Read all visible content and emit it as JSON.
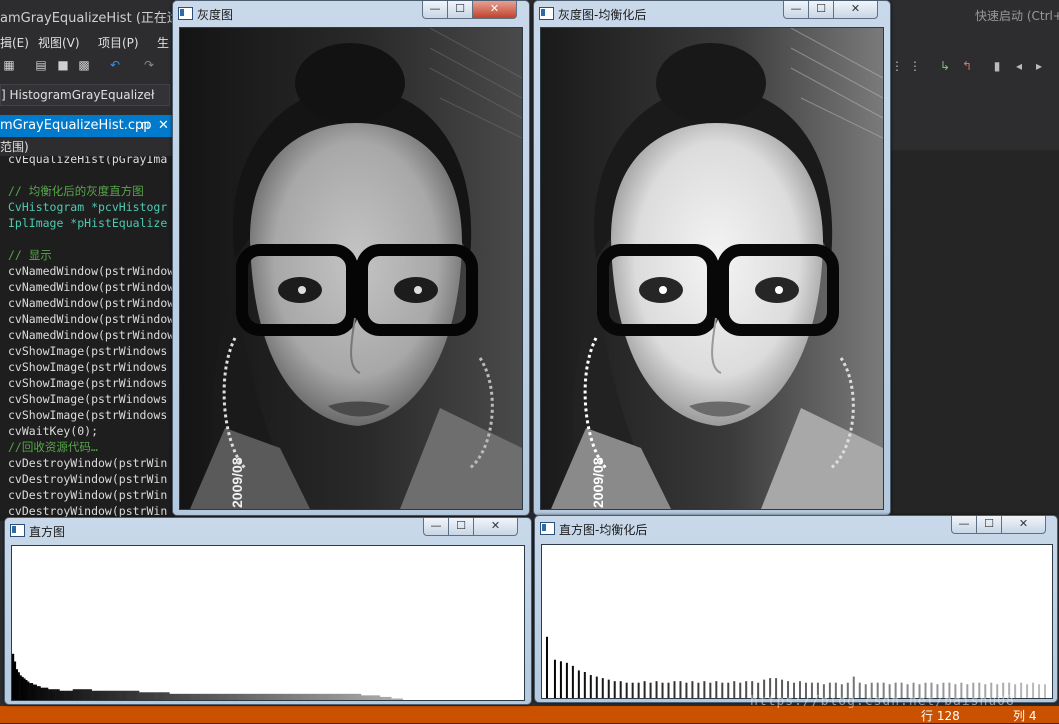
{
  "vs": {
    "title": "amGrayEqualizeHist (正在运行",
    "quick_launch": "快速启动 (Ctrl+",
    "menu": [
      "揖(E)",
      "视图(V)",
      "项目(P)",
      "生"
    ],
    "config": "] HistogramGrayEqualizeł",
    "tab_label": "mGrayEqualizeHist.cpp",
    "tab_pin": "⊓",
    "tab_close": "✕",
    "scope": "范围)",
    "code": [
      {
        "text": "cvEqualizeHist(pGrayIma",
        "kind": "code"
      },
      {
        "text": "",
        "kind": "code"
      },
      {
        "text": "// 均衡化后的灰度直方图",
        "kind": "cm"
      },
      {
        "text": "CvHistogram *pcvHistogr",
        "kind": "ty"
      },
      {
        "text": "IplImage *pHistEqualize",
        "kind": "ty"
      },
      {
        "text": "",
        "kind": "code"
      },
      {
        "text": "// 显示",
        "kind": "cm"
      },
      {
        "text": "cvNamedWindow(pstrWindow",
        "kind": "code"
      },
      {
        "text": "cvNamedWindow(pstrWindow",
        "kind": "code"
      },
      {
        "text": "cvNamedWindow(pstrWindow",
        "kind": "code"
      },
      {
        "text": "cvNamedWindow(pstrWindow",
        "kind": "code"
      },
      {
        "text": "cvNamedWindow(pstrWindow",
        "kind": "code"
      },
      {
        "text": "cvShowImage(pstrWindows",
        "kind": "code"
      },
      {
        "text": "cvShowImage(pstrWindows",
        "kind": "code"
      },
      {
        "text": "cvShowImage(pstrWindows",
        "kind": "code"
      },
      {
        "text": "cvShowImage(pstrWindows",
        "kind": "code"
      },
      {
        "text": "cvShowImage(pstrWindows",
        "kind": "code"
      },
      {
        "text": "cvWaitKey(0);",
        "kind": "code"
      },
      {
        "text": "//回收资源代码…",
        "kind": "cm"
      },
      {
        "text": "cvDestroyWindow(pstrWin",
        "kind": "code"
      },
      {
        "text": "cvDestroyWindow(pstrWin",
        "kind": "code"
      },
      {
        "text": "cvDestroyWindow(pstrWin",
        "kind": "code"
      },
      {
        "text": "cvDestroyWindow(pstrWin",
        "kind": "code"
      }
    ],
    "status_line": "行 128",
    "status_col": "列 4",
    "watermark": "https://blog.csdn.net/baishu08"
  },
  "windows": {
    "gray": {
      "title": "灰度图",
      "photo_stamp": "2009/08"
    },
    "equalized": {
      "title": "灰度图-均衡化后",
      "photo_stamp": "2009/08"
    },
    "hist": {
      "title": "直方图"
    },
    "hist_eq": {
      "title": "直方图-均衡化后"
    }
  },
  "controls": {
    "minimize": "—",
    "maximize": "☐",
    "close": "✕"
  },
  "icons": [
    "minimize-icon",
    "maximize-icon",
    "close-icon",
    "window-app-icon"
  ],
  "colors": {
    "vs_accent": "#007acc",
    "vs_status": "#ca5100",
    "close_hover": "#c1422c"
  },
  "chart_data": [
    {
      "type": "bar",
      "title": "直方图",
      "xlabel": "",
      "ylabel": "",
      "xlim": [
        0,
        255
      ],
      "ylim": [
        0,
        1
      ],
      "grid": false,
      "values": [
        0.3,
        0.25,
        0.2,
        0.18,
        0.16,
        0.15,
        0.14,
        0.13,
        0.12,
        0.11,
        0.11,
        0.1,
        0.1,
        0.09,
        0.09,
        0.08,
        0.08,
        0.08,
        0.08,
        0.07,
        0.07,
        0.07,
        0.07,
        0.07,
        0.07,
        0.06,
        0.06,
        0.06,
        0.06,
        0.06,
        0.06,
        0.06,
        0.07,
        0.07,
        0.07,
        0.07,
        0.07,
        0.07,
        0.07,
        0.07,
        0.07,
        0.07,
        0.06,
        0.06,
        0.06,
        0.06,
        0.06,
        0.06,
        0.06,
        0.06,
        0.06,
        0.06,
        0.06,
        0.06,
        0.06,
        0.06,
        0.06,
        0.06,
        0.06,
        0.06,
        0.06,
        0.06,
        0.06,
        0.06,
        0.06,
        0.06,
        0.06,
        0.05,
        0.05,
        0.05,
        0.05,
        0.05,
        0.05,
        0.05,
        0.05,
        0.05,
        0.05,
        0.05,
        0.05,
        0.05,
        0.05,
        0.05,
        0.05,
        0.04,
        0.04,
        0.04,
        0.04,
        0.04,
        0.04,
        0.04,
        0.04,
        0.04,
        0.04,
        0.04,
        0.04,
        0.04,
        0.04,
        0.04,
        0.04,
        0.04,
        0.04,
        0.04,
        0.04,
        0.04,
        0.04,
        0.04,
        0.04,
        0.04,
        0.04,
        0.04,
        0.04,
        0.04,
        0.04,
        0.04,
        0.04,
        0.04,
        0.04,
        0.04,
        0.04,
        0.04,
        0.04,
        0.04,
        0.04,
        0.04,
        0.04,
        0.04,
        0.04,
        0.04,
        0.04,
        0.04,
        0.04,
        0.04,
        0.04,
        0.04,
        0.04,
        0.04,
        0.04,
        0.04,
        0.04,
        0.04,
        0.04,
        0.04,
        0.04,
        0.04,
        0.04,
        0.04,
        0.04,
        0.04,
        0.04,
        0.04,
        0.04,
        0.04,
        0.04,
        0.04,
        0.04,
        0.04,
        0.04,
        0.04,
        0.04,
        0.04,
        0.04,
        0.04,
        0.04,
        0.04,
        0.04,
        0.04,
        0.04,
        0.04,
        0.04,
        0.04,
        0.04,
        0.04,
        0.04,
        0.04,
        0.04,
        0.04,
        0.04,
        0.04,
        0.04,
        0.04,
        0.04,
        0.04,
        0.04,
        0.04,
        0.03,
        0.03,
        0.03,
        0.03,
        0.03,
        0.03,
        0.03,
        0.03,
        0.03,
        0.03,
        0.02,
        0.02,
        0.02,
        0.02,
        0.02,
        0.02,
        0.01,
        0.01,
        0.01,
        0.01,
        0.01,
        0.01,
        0,
        0,
        0,
        0,
        0,
        0,
        0,
        0,
        0,
        0,
        0,
        0,
        0,
        0,
        0,
        0,
        0,
        0,
        0,
        0,
        0,
        0,
        0,
        0,
        0,
        0,
        0,
        0,
        0,
        0,
        0,
        0,
        0,
        0,
        0,
        0,
        0,
        0,
        0,
        0,
        0,
        0,
        0,
        0,
        0,
        0,
        0,
        0,
        0,
        0,
        0,
        0,
        0,
        0,
        0,
        0,
        0,
        0,
        0,
        0,
        0,
        0,
        0,
        0
      ]
    },
    {
      "type": "bar",
      "title": "直方图-均衡化后",
      "xlabel": "",
      "ylabel": "",
      "xlim": [
        0,
        255
      ],
      "ylim": [
        0,
        1
      ],
      "grid": false,
      "bins": [
        2,
        6,
        9,
        12,
        15,
        18,
        21,
        24,
        27,
        30,
        33,
        36,
        39,
        42,
        45,
        48,
        51,
        54,
        57,
        60,
        63,
        66,
        69,
        72,
        75,
        78,
        81,
        84,
        87,
        90,
        93,
        96,
        99,
        102,
        105,
        108,
        111,
        114,
        117,
        120,
        123,
        126,
        129,
        132,
        135,
        138,
        141,
        144,
        147,
        150,
        153,
        156,
        159,
        162,
        165,
        168,
        171,
        174,
        177,
        180,
        183,
        186,
        189,
        192,
        195,
        198,
        201,
        204,
        207,
        210,
        213,
        216,
        219,
        222,
        225,
        228,
        231,
        234,
        237,
        240,
        243,
        246,
        249,
        252
      ],
      "values": [
        0.4,
        0.25,
        0.24,
        0.23,
        0.21,
        0.18,
        0.17,
        0.15,
        0.14,
        0.13,
        0.12,
        0.11,
        0.11,
        0.1,
        0.1,
        0.1,
        0.11,
        0.1,
        0.11,
        0.1,
        0.1,
        0.11,
        0.11,
        0.1,
        0.11,
        0.1,
        0.11,
        0.1,
        0.11,
        0.1,
        0.1,
        0.11,
        0.1,
        0.11,
        0.11,
        0.1,
        0.12,
        0.13,
        0.13,
        0.12,
        0.11,
        0.1,
        0.11,
        0.1,
        0.1,
        0.1,
        0.09,
        0.1,
        0.1,
        0.09,
        0.1,
        0.14,
        0.1,
        0.09,
        0.1,
        0.1,
        0.1,
        0.09,
        0.1,
        0.1,
        0.09,
        0.1,
        0.09,
        0.1,
        0.1,
        0.09,
        0.1,
        0.1,
        0.09,
        0.1,
        0.09,
        0.1,
        0.1,
        0.09,
        0.1,
        0.09,
        0.1,
        0.1,
        0.09,
        0.1,
        0.09,
        0.1,
        0.09,
        0.09
      ]
    }
  ]
}
